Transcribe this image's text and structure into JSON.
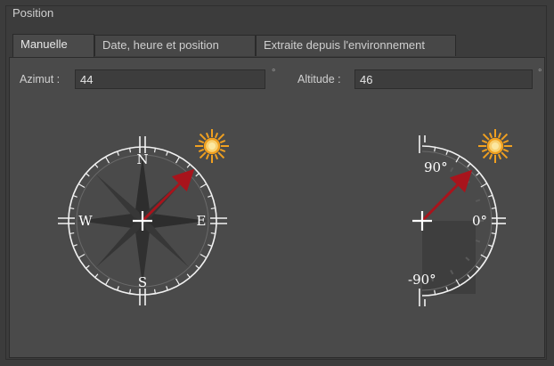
{
  "group": {
    "title": "Position"
  },
  "tabs": [
    {
      "label": "Manuelle",
      "active": true
    },
    {
      "label": "Date, heure et position",
      "active": false
    },
    {
      "label": "Extraite depuis l'environnement",
      "active": false
    }
  ],
  "azimuth": {
    "label": "Azimut :",
    "value": "44",
    "unit": "°"
  },
  "altitude": {
    "label": "Altitude :",
    "value": "46",
    "unit": "°"
  },
  "compass": {
    "north": "N",
    "south": "S",
    "east": "E",
    "west": "W",
    "sun_icon": "sun-icon"
  },
  "altimeter": {
    "label_top": "90°",
    "label_mid": "0°",
    "label_bottom": "-90°",
    "sun_icon": "sun-icon"
  },
  "colors": {
    "arrow": "#a8141c",
    "sun": "#f0a020",
    "dial": "#f2f2f2"
  }
}
